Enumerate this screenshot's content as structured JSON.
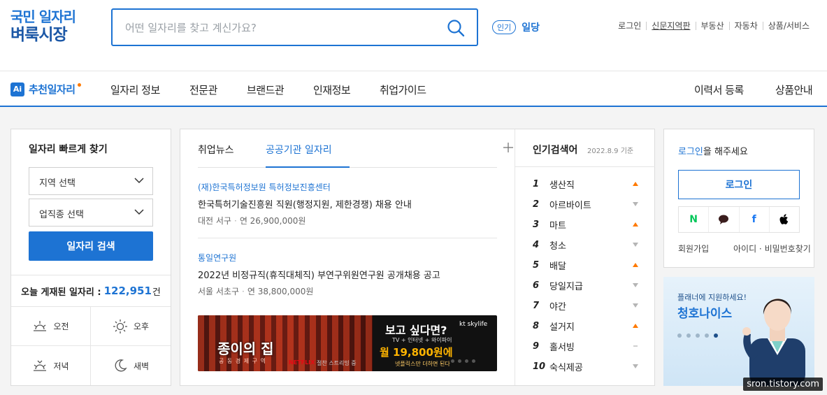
{
  "logo": {
    "line1": "국민 일자리",
    "line2": "벼룩시장"
  },
  "search": {
    "placeholder": "어떤 일자리를 찾고 계신가요?"
  },
  "hot": {
    "pill": "인기",
    "keyword": "일당"
  },
  "util": [
    "로그인",
    "신문지역판",
    "부동산",
    "자동차",
    "상품/서비스"
  ],
  "nav": {
    "ai_badge": "Ai",
    "ai_label": "추천일자리",
    "menu": [
      "일자리 정보",
      "전문관",
      "브랜드관",
      "인재정보",
      "취업가이드"
    ],
    "right": [
      "이력서 등록",
      "상품안내"
    ]
  },
  "quick": {
    "title": "일자리 빠르게 찾기",
    "region": "지역 선택",
    "industry": "업직종 선택",
    "button": "일자리 검색",
    "today_label": "오늘 게재된 일자리 :",
    "today_count": "122,951",
    "today_unit": "건",
    "times": [
      "오전",
      "오후",
      "저녁",
      "새벽"
    ]
  },
  "news": {
    "tabs": [
      "취업뉴스",
      "공공기관 일자리"
    ],
    "articles": [
      {
        "org": "(재)한국특허정보원 특허정보진흥센터",
        "title": "한국특허기술진흥원 직원(행정지원, 제한경쟁) 채용 안내",
        "loc": "대전 서구",
        "salary": "연 26,900,000원"
      },
      {
        "org": "통일연구원",
        "title": "2022년 비정규직(휴직대체직) 부연구위원연구원 공개채용 공고",
        "loc": "서울 서초구",
        "salary": "연 38,800,000원"
      }
    ],
    "banner": {
      "show": "종이의 집",
      "tagline": "공 동 경 제 구 역",
      "netflix": "NETFLIX",
      "now": "절찬 스트리밍 중",
      "headline": "보고 싶다면?",
      "brand": "kt skylife",
      "sub": "TV + 인터넷 + 와이파이",
      "price": "월 19,800원에",
      "sub2": "넷플릭스만 더하면 된다"
    }
  },
  "popular": {
    "title": "인기검색어",
    "date": "2022.8.9 기준",
    "items": [
      {
        "rank": "1",
        "kw": "생산직",
        "trend": "up"
      },
      {
        "rank": "2",
        "kw": "아르바이트",
        "trend": "down"
      },
      {
        "rank": "3",
        "kw": "마트",
        "trend": "up"
      },
      {
        "rank": "4",
        "kw": "청소",
        "trend": "down"
      },
      {
        "rank": "5",
        "kw": "배달",
        "trend": "up"
      },
      {
        "rank": "6",
        "kw": "당일지급",
        "trend": "down"
      },
      {
        "rank": "7",
        "kw": "야간",
        "trend": "down"
      },
      {
        "rank": "8",
        "kw": "설거지",
        "trend": "up"
      },
      {
        "rank": "9",
        "kw": "홀서빙",
        "trend": "same"
      },
      {
        "rank": "10",
        "kw": "숙식제공",
        "trend": "down"
      }
    ],
    "colors": {
      "up": "#ff7a00",
      "down": "#b5b5b5",
      "same": "#b5b5b5"
    }
  },
  "login": {
    "prompt_link": "로그인",
    "prompt_rest": "을 해주세요",
    "button": "로그인",
    "social": [
      "N",
      "",
      "f",
      ""
    ],
    "join": "회원가입",
    "find": "아이디 · 비밀번호찾기"
  },
  "promo": {
    "text": "플래너에 지원하세요!",
    "name": "청호나이스"
  },
  "watermark": "sron.tistory.com"
}
